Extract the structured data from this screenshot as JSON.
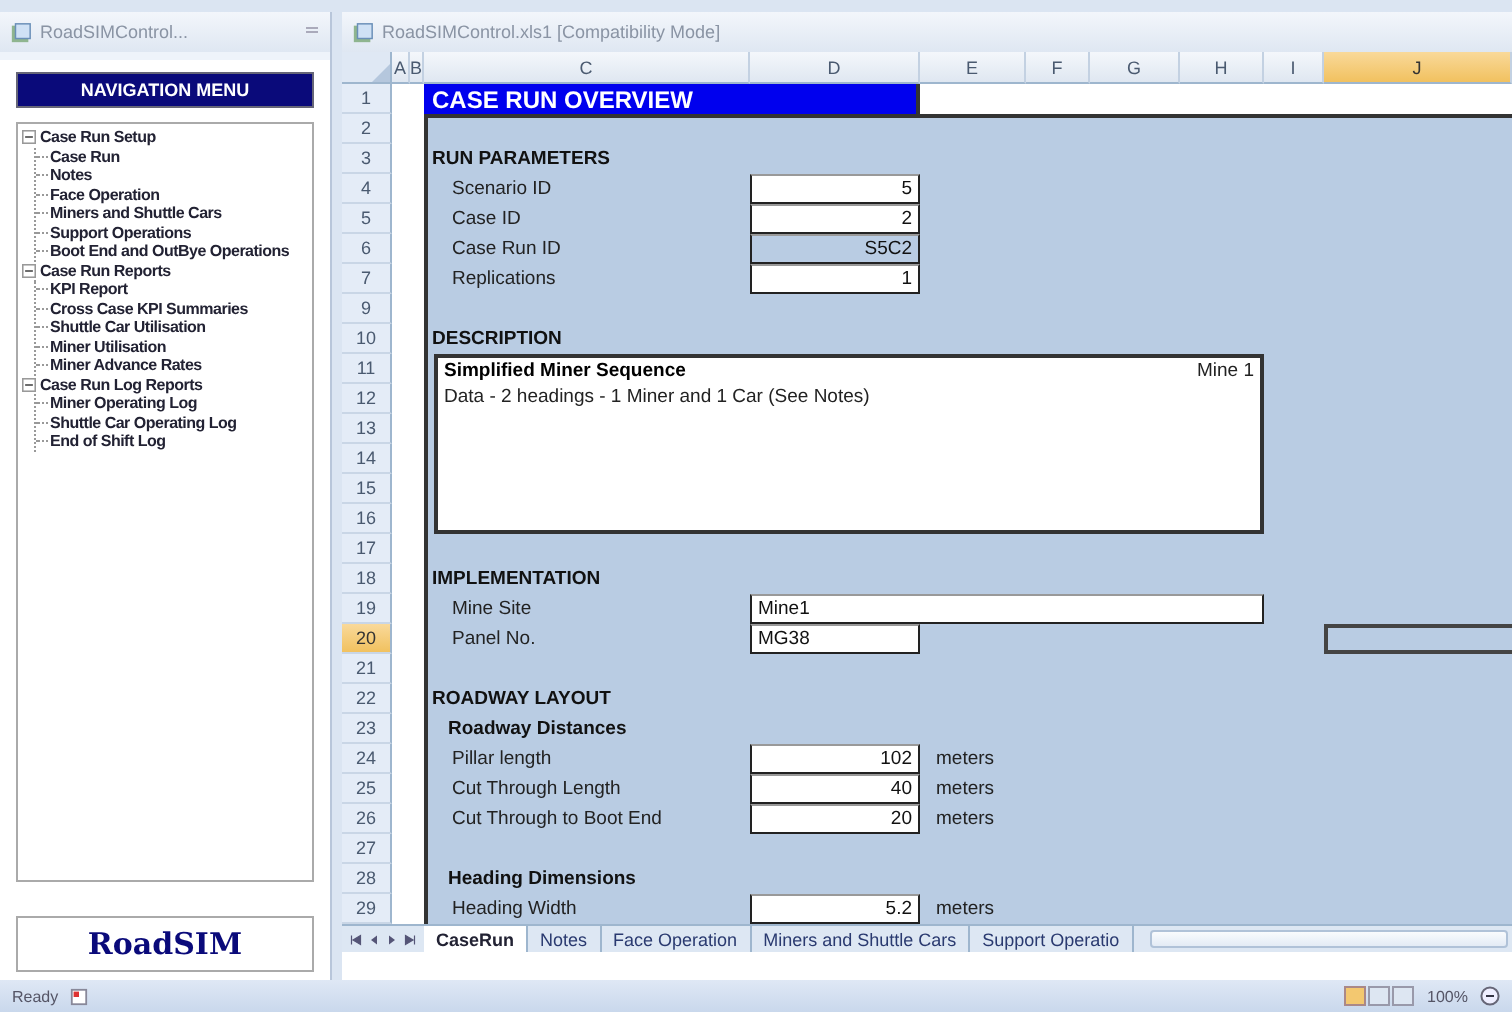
{
  "left_pane": {
    "title": "RoadSIMControl...",
    "nav_header": "NAVIGATION MENU",
    "tree": [
      {
        "label": "Case Run Setup",
        "expanded": true,
        "children": [
          {
            "label": "Case Run"
          },
          {
            "label": "Notes"
          },
          {
            "label": "Face Operation"
          },
          {
            "label": "Miners and Shuttle Cars"
          },
          {
            "label": "Support Operations"
          },
          {
            "label": "Boot End and OutBye Operations"
          }
        ]
      },
      {
        "label": "Case Run Reports",
        "expanded": true,
        "children": [
          {
            "label": "KPI Report"
          },
          {
            "label": "Cross Case KPI Summaries"
          },
          {
            "label": "Shuttle Car Utilisation"
          },
          {
            "label": "Miner Utilisation"
          },
          {
            "label": "Miner Advance Rates"
          }
        ]
      },
      {
        "label": "Case Run Log Reports",
        "expanded": true,
        "children": [
          {
            "label": "Miner Operating Log"
          },
          {
            "label": "Shuttle Car Operating Log"
          },
          {
            "label": "End of Shift Log"
          }
        ]
      }
    ],
    "logo": "RoadSIM"
  },
  "workbook": {
    "title": "RoadSIMControl.xls1  [Compatibility Mode]",
    "columns": [
      {
        "label": "A",
        "selected": false
      },
      {
        "label": "B",
        "selected": false
      },
      {
        "label": "C",
        "selected": false
      },
      {
        "label": "D",
        "selected": false
      },
      {
        "label": "E",
        "selected": false
      },
      {
        "label": "F",
        "selected": false
      },
      {
        "label": "G",
        "selected": false
      },
      {
        "label": "H",
        "selected": false
      },
      {
        "label": "I",
        "selected": false
      },
      {
        "label": "J",
        "selected": true
      }
    ],
    "rows": [
      {
        "number": "1",
        "selected": false,
        "kind": "title",
        "text": "CASE RUN OVERVIEW"
      },
      {
        "number": "2",
        "selected": false
      },
      {
        "number": "3",
        "selected": false,
        "kind": "section",
        "text": "RUN PARAMETERS"
      },
      {
        "number": "4",
        "selected": false,
        "kind": "number_field",
        "label": "Scenario ID",
        "value": "5",
        "computed": false
      },
      {
        "number": "5",
        "selected": false,
        "kind": "number_field",
        "label": "Case ID",
        "value": "2",
        "computed": false
      },
      {
        "number": "6",
        "selected": false,
        "kind": "number_field",
        "label": "Case Run ID",
        "value": "S5C2",
        "computed": true
      },
      {
        "number": "7",
        "selected": false,
        "kind": "number_field",
        "label": "Replications",
        "value": "1",
        "computed": false
      },
      {
        "number": "9",
        "selected": false
      },
      {
        "number": "10",
        "selected": false,
        "kind": "section",
        "text": "DESCRIPTION"
      },
      {
        "number": "11",
        "selected": false,
        "kind": "description",
        "heading": "Simplified Miner Sequence",
        "body": "Data - 2 headings - 1 Miner and 1 Car (See Notes)",
        "tag": "Mine 1"
      },
      {
        "number": "12",
        "selected": false
      },
      {
        "number": "13",
        "selected": false
      },
      {
        "number": "14",
        "selected": false
      },
      {
        "number": "15",
        "selected": false
      },
      {
        "number": "16",
        "selected": false
      },
      {
        "number": "17",
        "selected": false
      },
      {
        "number": "18",
        "selected": false,
        "kind": "section",
        "text": "IMPLEMENTATION"
      },
      {
        "number": "19",
        "selected": false,
        "kind": "text_field",
        "label": "Mine Site",
        "value": "Mine1",
        "computed": false,
        "wide": true
      },
      {
        "number": "20",
        "selected": true,
        "kind": "text_field",
        "label": "Panel No.",
        "value": "MG38",
        "computed": false,
        "extra_box": true
      },
      {
        "number": "21",
        "selected": false
      },
      {
        "number": "22",
        "selected": false,
        "kind": "section",
        "text": "ROADWAY LAYOUT"
      },
      {
        "number": "23",
        "selected": false,
        "kind": "subsection",
        "text": "Roadway Distances"
      },
      {
        "number": "24",
        "selected": false,
        "kind": "number_field",
        "label": "Pillar length",
        "value": "102",
        "computed": false,
        "unit": "meters"
      },
      {
        "number": "25",
        "selected": false,
        "kind": "number_field",
        "label": "Cut Through Length",
        "value": "40",
        "computed": false,
        "unit": "meters"
      },
      {
        "number": "26",
        "selected": false,
        "kind": "number_field",
        "label": "Cut Through to Boot End",
        "value": "20",
        "computed": false,
        "unit": "meters"
      },
      {
        "number": "27",
        "selected": false
      },
      {
        "number": "28",
        "selected": false,
        "kind": "subsection",
        "text": "Heading Dimensions"
      },
      {
        "number": "29",
        "selected": false,
        "kind": "number_field",
        "label": "Heading Width",
        "value": "5.2",
        "computed": false,
        "unit": "meters"
      }
    ]
  },
  "sheet_tabs": [
    {
      "label": "CaseRun",
      "selected": true
    },
    {
      "label": "Notes",
      "selected": false
    },
    {
      "label": "Face Operation",
      "selected": false
    },
    {
      "label": "Miners and Shuttle Cars",
      "selected": false
    },
    {
      "label": "Support Operatio",
      "selected": false
    }
  ],
  "status_bar": {
    "status": "Ready",
    "zoom": "100%"
  }
}
